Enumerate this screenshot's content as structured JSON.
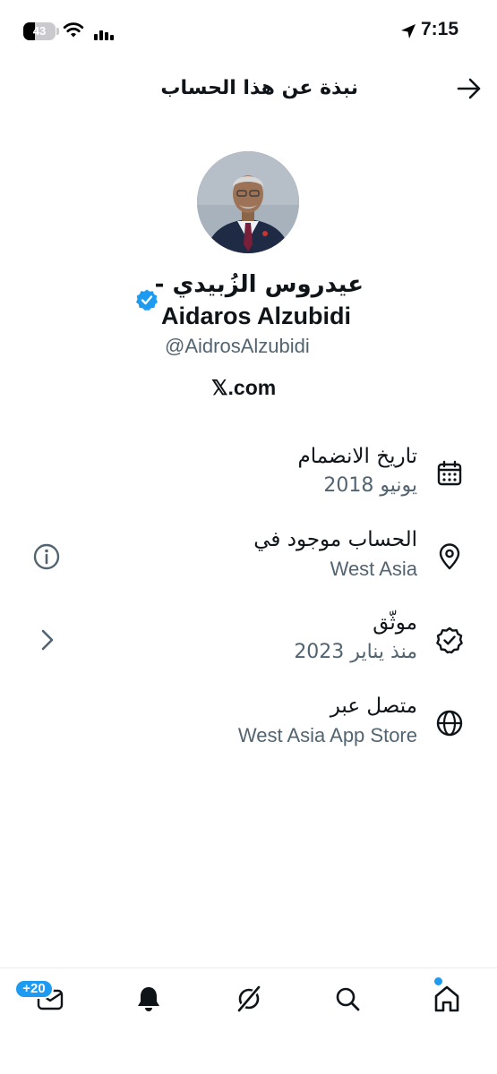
{
  "status_bar": {
    "battery": "43",
    "time": "7:15"
  },
  "header": {
    "title": "نبذة عن هذا الحساب"
  },
  "profile": {
    "name_ar": "عيدروس الزُبيدي -",
    "name_en": "Aidaros Alzubidi",
    "handle": "@AidrosAlzubidi",
    "website": "𝕏.com"
  },
  "rows": [
    {
      "title": "تاريخ الانضمام",
      "value": "يونيو 2018",
      "icon": "calendar-icon"
    },
    {
      "title": "الحساب موجود في",
      "value": "West Asia",
      "icon": "location-pin-icon",
      "action_icon": "info-icon"
    },
    {
      "title": "موثّق",
      "value": "منذ يناير 2023",
      "icon": "verified-badge-outline-icon",
      "action_icon": "chevron-right-icon"
    },
    {
      "title": "متصل عبر",
      "value": "West Asia App Store",
      "icon": "globe-icon"
    }
  ],
  "tab_bar": {
    "messages_badge": "+20",
    "tabs": [
      "messages-icon",
      "notifications-bell-icon",
      "grok-icon",
      "search-icon",
      "home-icon"
    ]
  },
  "colors": {
    "accent": "#1d9bf0",
    "secondary_text": "#536471",
    "primary_text": "#0f1419"
  }
}
